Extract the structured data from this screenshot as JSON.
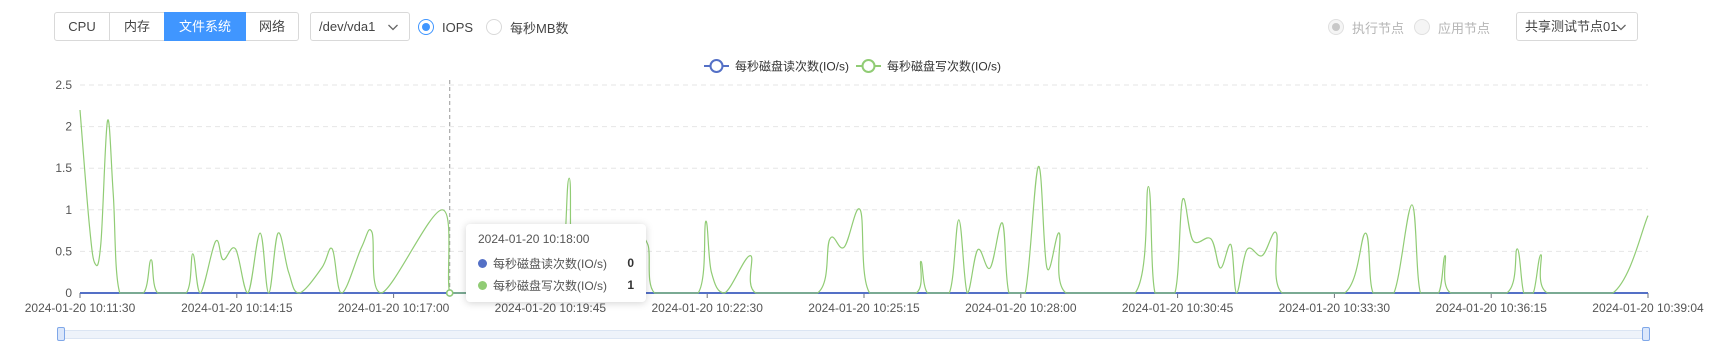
{
  "toolbar": {
    "tabs": [
      {
        "label": "CPU",
        "active": false
      },
      {
        "label": "内存",
        "active": false
      },
      {
        "label": "文件系统",
        "active": true
      },
      {
        "label": "网络",
        "active": false
      }
    ],
    "device_select": "/dev/vda1",
    "metric_radios": [
      {
        "label": "IOPS",
        "checked": true,
        "disabled": false
      },
      {
        "label": "每秒MB数",
        "checked": false,
        "disabled": false
      }
    ],
    "node_radios": [
      {
        "label": "执行节点",
        "checked": true,
        "disabled": true
      },
      {
        "label": "应用节点",
        "checked": false,
        "disabled": true
      }
    ],
    "node_select": "共享测试节点01"
  },
  "tooltip": {
    "title": "2024-01-20 10:18:00",
    "rows": [
      {
        "name": "每秒磁盘读次数(IO/s)",
        "value": "0"
      },
      {
        "name": "每秒磁盘写次数(IO/s)",
        "value": "1"
      }
    ]
  },
  "chart_data": {
    "type": "line",
    "legend_position": "top-center",
    "grid": true,
    "x_ticks": [
      "2024-01-20 10:11:30",
      "2024-01-20 10:14:15",
      "2024-01-20 10:17:00",
      "2024-01-20 10:19:45",
      "2024-01-20 10:22:30",
      "2024-01-20 10:25:15",
      "2024-01-20 10:28:00",
      "2024-01-20 10:30:45",
      "2024-01-20 10:33:30",
      "2024-01-20 10:36:15",
      "2024-01-20 10:39:04"
    ],
    "y_ticks": [
      "0",
      "0.5",
      "1",
      "1.5",
      "2",
      "2.5"
    ],
    "ylim": [
      0,
      2.5
    ],
    "x_range_seconds": [
      0,
      1654
    ],
    "series": [
      {
        "name": "每秒磁盘读次数(IO/s)",
        "color": "#5470c6",
        "points": [
          [
            0,
            0
          ],
          [
            1654,
            0
          ]
        ]
      },
      {
        "name": "每秒磁盘写次数(IO/s)",
        "color": "#91cc75",
        "points": [
          [
            0,
            2.2
          ],
          [
            10,
            0.8
          ],
          [
            16,
            0.35
          ],
          [
            22,
            0.6
          ],
          [
            29,
            2.07
          ],
          [
            35,
            1.2
          ],
          [
            42,
            0
          ],
          [
            67,
            0
          ],
          [
            75,
            0.4
          ],
          [
            82,
            0
          ],
          [
            112,
            0
          ],
          [
            119,
            0.47
          ],
          [
            127,
            0
          ],
          [
            143,
            0.62
          ],
          [
            151,
            0.4
          ],
          [
            164,
            0.53
          ],
          [
            177,
            0
          ],
          [
            190,
            0.72
          ],
          [
            199,
            0
          ],
          [
            209,
            0.72
          ],
          [
            220,
            0.25
          ],
          [
            231,
            0
          ],
          [
            255,
            0.3
          ],
          [
            266,
            0.53
          ],
          [
            276,
            0
          ],
          [
            297,
            0.55
          ],
          [
            308,
            0.73
          ],
          [
            318,
            0
          ],
          [
            382,
            1.0
          ],
          [
            390,
            0
          ],
          [
            406,
            0
          ],
          [
            423,
            0
          ],
          [
            438,
            0.5
          ],
          [
            451,
            0
          ],
          [
            503,
            0
          ],
          [
            516,
            1.38
          ],
          [
            525,
            0
          ],
          [
            584,
            0.56
          ],
          [
            599,
            0.58
          ],
          [
            606,
            0
          ],
          [
            652,
            0
          ],
          [
            660,
            0.86
          ],
          [
            666,
            0.25
          ],
          [
            680,
            0
          ],
          [
            707,
            0.45
          ],
          [
            713,
            0
          ],
          [
            778,
            0
          ],
          [
            791,
            0.65
          ],
          [
            806,
            0.55
          ],
          [
            823,
            1.0
          ],
          [
            833,
            0
          ],
          [
            882,
            0
          ],
          [
            887,
            0.38
          ],
          [
            894,
            0
          ],
          [
            917,
            0
          ],
          [
            927,
            0.88
          ],
          [
            936,
            0
          ],
          [
            947,
            0.52
          ],
          [
            960,
            0.3
          ],
          [
            973,
            0.84
          ],
          [
            980,
            0
          ],
          [
            997,
            0
          ],
          [
            1011,
            1.52
          ],
          [
            1020,
            0.3
          ],
          [
            1033,
            0.72
          ],
          [
            1040,
            0
          ],
          [
            1113,
            0
          ],
          [
            1127,
            1.28
          ],
          [
            1134,
            0
          ],
          [
            1155,
            0
          ],
          [
            1163,
            1.12
          ],
          [
            1174,
            0.63
          ],
          [
            1193,
            0.65
          ],
          [
            1203,
            0.3
          ],
          [
            1214,
            0.58
          ],
          [
            1220,
            0
          ],
          [
            1231,
            0.52
          ],
          [
            1247,
            0.45
          ],
          [
            1262,
            0.72
          ],
          [
            1268,
            0
          ],
          [
            1334,
            0
          ],
          [
            1356,
            0.72
          ],
          [
            1364,
            0
          ],
          [
            1386,
            0
          ],
          [
            1405,
            1.06
          ],
          [
            1414,
            0
          ],
          [
            1433,
            0
          ],
          [
            1440,
            0.45
          ],
          [
            1446,
            0
          ],
          [
            1505,
            0
          ],
          [
            1516,
            0.53
          ],
          [
            1523,
            0
          ],
          [
            1533,
            0
          ],
          [
            1541,
            0.46
          ],
          [
            1548,
            0
          ],
          [
            1617,
            0
          ],
          [
            1654,
            0.93
          ]
        ]
      }
    ],
    "highlight_x_seconds": 390
  }
}
